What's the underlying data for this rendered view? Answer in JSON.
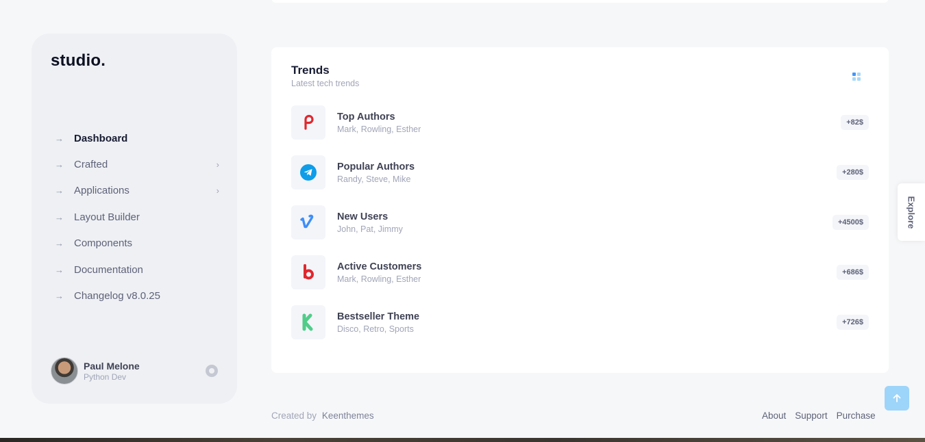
{
  "brand": {
    "logo": "studio."
  },
  "sidebar": {
    "items": [
      {
        "label": "Dashboard",
        "active": true,
        "has_submenu": false
      },
      {
        "label": "Crafted",
        "active": false,
        "has_submenu": true
      },
      {
        "label": "Applications",
        "active": false,
        "has_submenu": true
      },
      {
        "label": "Layout Builder",
        "active": false,
        "has_submenu": false
      },
      {
        "label": "Components",
        "active": false,
        "has_submenu": false
      },
      {
        "label": "Documentation",
        "active": false,
        "has_submenu": false
      },
      {
        "label": "Changelog v8.0.25",
        "active": false,
        "has_submenu": false
      }
    ],
    "arrow_glyph": "→",
    "chevron_glyph": "›"
  },
  "user": {
    "name": "Paul Melone",
    "role": "Python Dev"
  },
  "trends": {
    "title": "Trends",
    "subtitle": "Latest tech trends",
    "rows": [
      {
        "icon": "pinterest-icon",
        "color": "#e0282e",
        "title": "Top Authors",
        "desc": "Mark, Rowling, Esther",
        "badge": "+82$"
      },
      {
        "icon": "telegram-icon",
        "color": "#0f9de8",
        "title": "Popular Authors",
        "desc": "Randy, Steve, Mike",
        "badge": "+280$"
      },
      {
        "icon": "vimeo-icon",
        "color": "#3e8ef7",
        "title": "New Users",
        "desc": "John, Pat, Jimmy",
        "badge": "+4500$"
      },
      {
        "icon": "bebo-icon",
        "color": "#e0282e",
        "title": "Active Customers",
        "desc": "Mark, Rowling, Esther",
        "badge": "+686$"
      },
      {
        "icon": "kickstarter-icon",
        "color": "#50cd89",
        "title": "Bestseller Theme",
        "desc": "Disco, Retro, Sports",
        "badge": "+726$"
      }
    ]
  },
  "explore": {
    "label": "Explore"
  },
  "footer": {
    "created_by": "Created by",
    "brand": "Keenthemes",
    "links": [
      "About",
      "Support",
      "Purchase"
    ]
  },
  "colors": {
    "background": "#f6f7f9",
    "sidebar": "#eef0f4",
    "accent": "#3e97ff"
  }
}
